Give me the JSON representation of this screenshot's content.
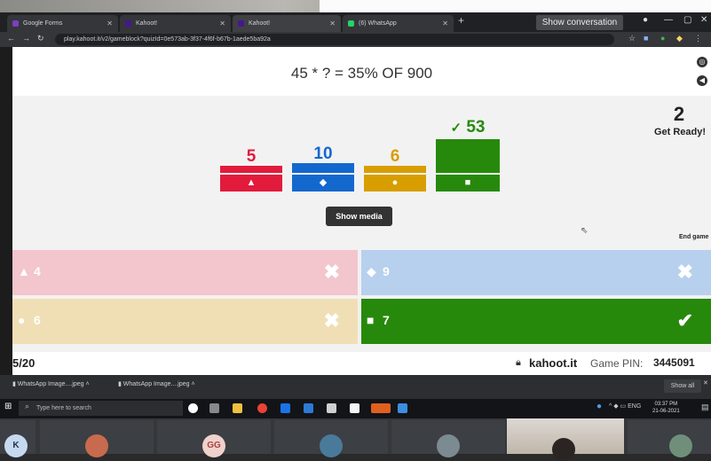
{
  "browser": {
    "tabs": [
      {
        "title": "Google Forms",
        "color": "#7b3fbf"
      },
      {
        "title": "Kahoot!",
        "color": "#46178f"
      },
      {
        "title": "Kahoot!",
        "color": "#46178f"
      },
      {
        "title": "(6) WhatsApp",
        "color": "#25d366"
      }
    ],
    "new_tab": "+",
    "show_conversation": "Show conversation",
    "url": "play.kahoot.it/v2/gameblock?quizId=0e573ab-3f37-4f6f-b67b-1aede5ba92a"
  },
  "kahoot": {
    "question": "45 * ? = 35% OF 900",
    "results": [
      {
        "count": "5",
        "shape": "▲",
        "color": "#e21b3c",
        "correct": false
      },
      {
        "count": "10",
        "shape": "◆",
        "color": "#1368ce",
        "correct": false
      },
      {
        "count": "6",
        "shape": "●",
        "color": "#d89e00",
        "correct": false
      },
      {
        "count": "53",
        "shape": "■",
        "color": "#26890c",
        "correct": true,
        "check": "✓"
      }
    ],
    "timer": "2",
    "get_ready": "Get Ready!",
    "show_media": "Show media",
    "end_game": "End game",
    "answers": [
      {
        "shape": "▲",
        "text": "4",
        "mark": "✖",
        "color": "#f3c5cd"
      },
      {
        "shape": "◆",
        "text": "9",
        "mark": "✖",
        "color": "#b7d0ee"
      },
      {
        "shape": "●",
        "text": "6",
        "mark": "✖",
        "color": "#f0dfb5"
      },
      {
        "shape": "■",
        "text": "7",
        "mark": "✔",
        "color": "#26890c"
      }
    ],
    "question_counter": "5/20",
    "site": "kahoot.it",
    "pin_label": "Game PIN:",
    "pin": "3445091"
  },
  "downloads": {
    "items": [
      "WhatsApp Image....jpeg",
      "WhatsApp Image....jpeg"
    ],
    "show_all": "Show all"
  },
  "taskbar": {
    "search_placeholder": "Type here to search",
    "time": "03:37 PM",
    "date": "21-06-2021",
    "lang": "ENG"
  },
  "meeting": {
    "initials": [
      "K",
      "GG"
    ]
  }
}
